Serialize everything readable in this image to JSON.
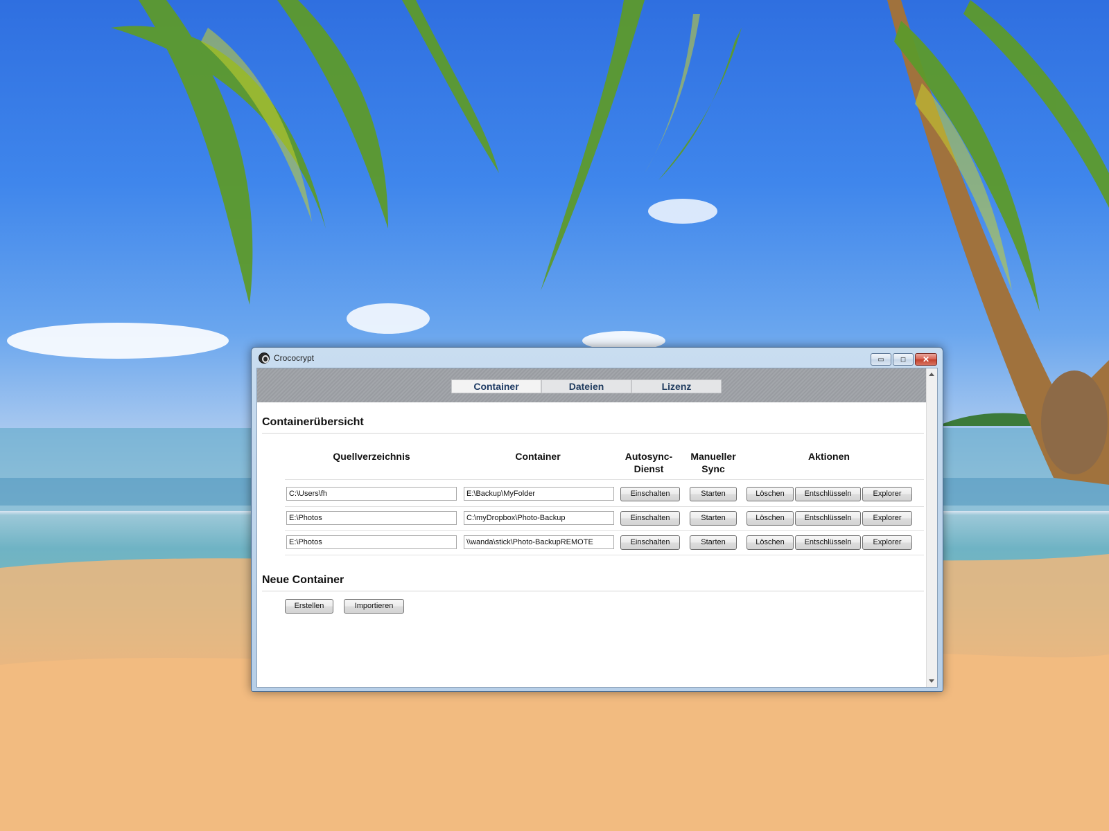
{
  "window": {
    "title": "Crococrypt",
    "controls": {
      "minimize": "▭",
      "maximize": "◻",
      "close": "✕"
    }
  },
  "tabs": [
    {
      "label": "Container",
      "active": true
    },
    {
      "label": "Dateien",
      "active": false
    },
    {
      "label": "Lizenz",
      "active": false
    }
  ],
  "overview": {
    "title": "Containerübersicht",
    "columns": {
      "source": "Quellverzeichnis",
      "container": "Container",
      "autosync_line1": "Autosync-",
      "autosync_line2": "Dienst",
      "manual_line1": "Manueller",
      "manual_line2": "Sync",
      "actions": "Aktionen"
    },
    "rows": [
      {
        "source": "C:\\Users\\fh",
        "container": "E:\\Backup\\MyFolder",
        "autosync": "Einschalten",
        "manual": "Starten",
        "delete": "Löschen",
        "decrypt": "Entschlüsseln",
        "explorer": "Explorer"
      },
      {
        "source": "E:\\Photos",
        "container": "C:\\myDropbox\\Photo-Backup",
        "autosync": "Einschalten",
        "manual": "Starten",
        "delete": "Löschen",
        "decrypt": "Entschlüsseln",
        "explorer": "Explorer"
      },
      {
        "source": "E:\\Photos",
        "container": "\\\\wanda\\stick\\Photo-BackupREMOTE",
        "autosync": "Einschalten",
        "manual": "Starten",
        "delete": "Löschen",
        "decrypt": "Entschlüsseln",
        "explorer": "Explorer"
      }
    ]
  },
  "new_container": {
    "title": "Neue Container",
    "create_label": "Erstellen",
    "import_label": "Importieren"
  },
  "icons": {
    "app": "crococrypt-logo-icon",
    "scroll_up": "scroll-up-arrow-icon",
    "scroll_down": "scroll-down-arrow-icon"
  }
}
